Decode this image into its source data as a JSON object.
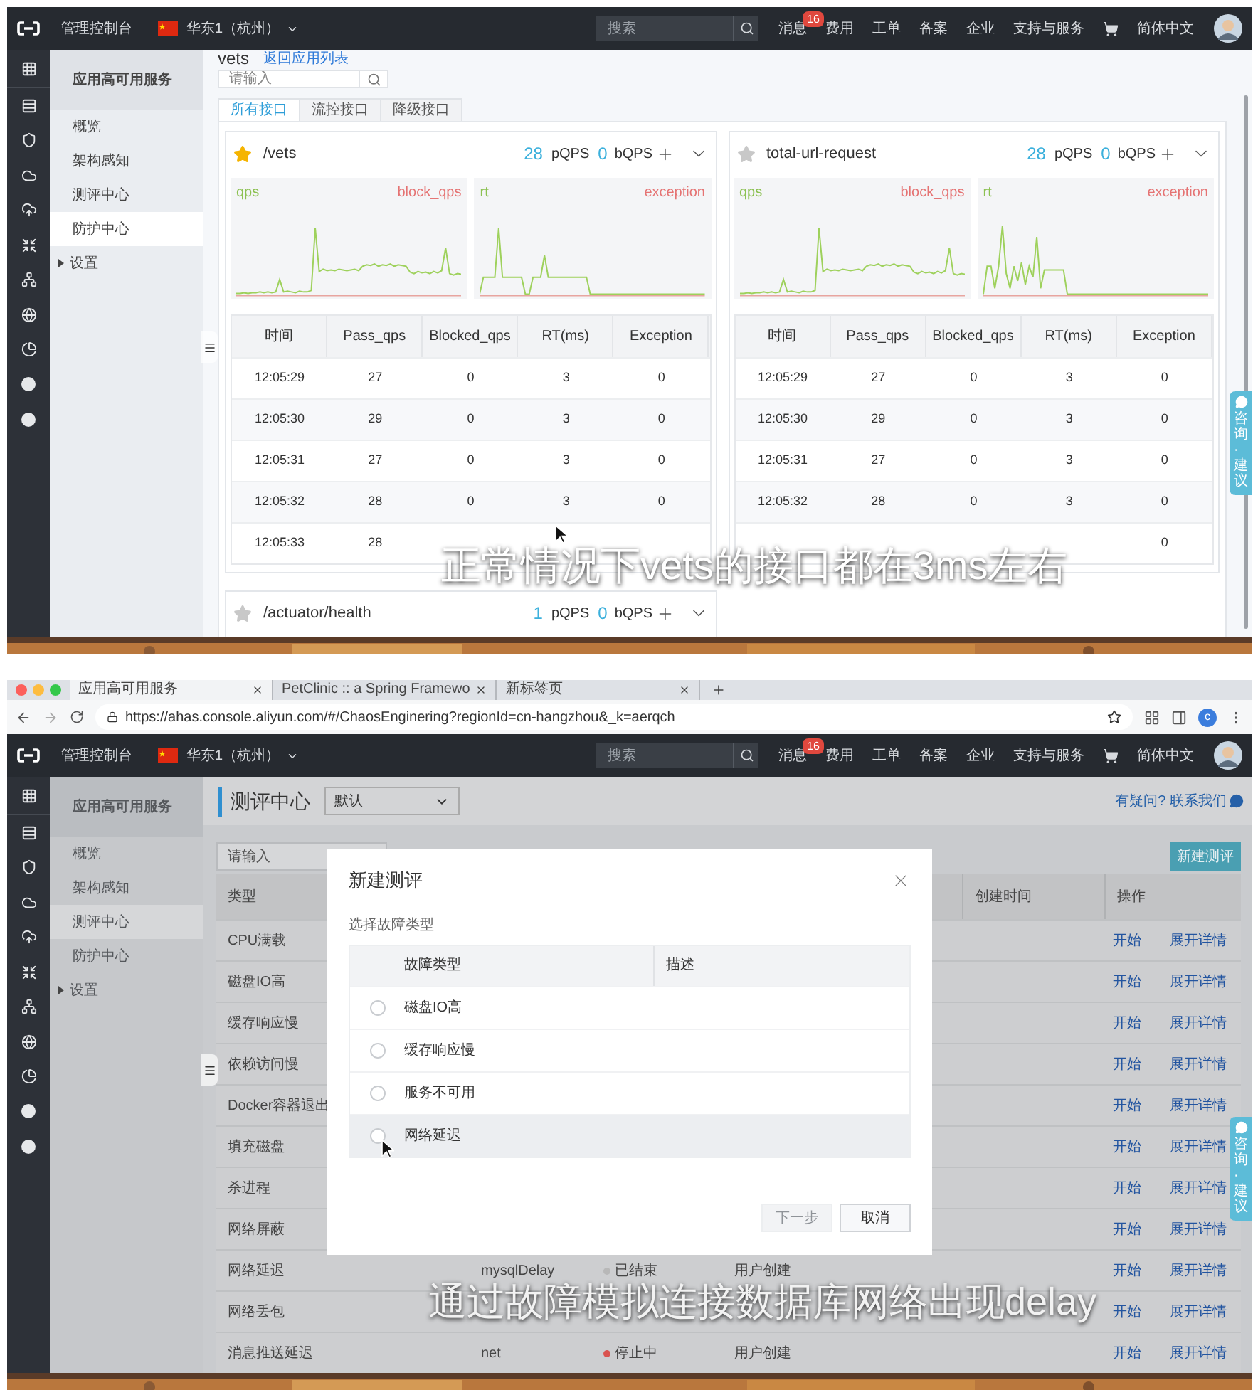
{
  "top_frame": {
    "header": {
      "console": "管理控制台",
      "region": "华东1（杭州）",
      "search_placeholder": "搜索",
      "nav": [
        {
          "label": "消息",
          "badge": "16"
        },
        {
          "label": "费用"
        },
        {
          "label": "工单"
        },
        {
          "label": "备案"
        },
        {
          "label": "企业"
        },
        {
          "label": "支持与服务"
        }
      ],
      "language": "简体中文"
    },
    "sidebar": {
      "title": "应用高可用服务",
      "items": [
        {
          "label": "概览",
          "selected": false,
          "expandable": false
        },
        {
          "label": "架构感知",
          "selected": false,
          "expandable": false
        },
        {
          "label": "测评中心",
          "selected": false,
          "expandable": false
        },
        {
          "label": "防护中心",
          "selected": true,
          "expandable": false
        },
        {
          "label": "设置",
          "selected": false,
          "expandable": true
        }
      ]
    },
    "app_title": "vets",
    "back_link": "返回应用列表",
    "search": {
      "placeholder": "请输入"
    },
    "tabs": [
      {
        "label": "所有接口",
        "selected": true
      },
      {
        "label": "流控接口",
        "selected": false
      },
      {
        "label": "降级接口",
        "selected": false
      }
    ],
    "cards": [
      {
        "name": "/vets",
        "starred": true,
        "pass_qps": "28",
        "pass_label": "pQPS",
        "block_qps": "0",
        "block_label": "bQPS",
        "charts": [
          {
            "kind": "qps",
            "left": "qps",
            "right": "block_qps"
          },
          {
            "kind": "rt",
            "left": "rt",
            "right": "exception"
          }
        ],
        "table": {
          "columns": [
            "时间",
            "Pass_qps",
            "Blocked_qps",
            "RT(ms)",
            "Exception"
          ],
          "rows": [
            [
              "12:05:29",
              "27",
              "0",
              "3",
              "0"
            ],
            [
              "12:05:30",
              "29",
              "0",
              "3",
              "0"
            ],
            [
              "12:05:31",
              "27",
              "0",
              "3",
              "0"
            ],
            [
              "12:05:32",
              "28",
              "0",
              "3",
              "0"
            ],
            [
              "12:05:33",
              "28",
              null,
              null,
              null
            ]
          ]
        }
      },
      {
        "name": "total-url-request",
        "starred": false,
        "pass_qps": "28",
        "pass_label": "pQPS",
        "block_qps": "0",
        "block_label": "bQPS",
        "charts": [
          {
            "kind": "qps",
            "left": "qps",
            "right": "block_qps"
          },
          {
            "kind": "rt2",
            "left": "rt",
            "right": "exception"
          }
        ],
        "table": {
          "columns": [
            "时间",
            "Pass_qps",
            "Blocked_qps",
            "RT(ms)",
            "Exception"
          ],
          "rows": [
            [
              "12:05:29",
              "27",
              "0",
              "3",
              "0"
            ],
            [
              "12:05:30",
              "29",
              "0",
              "3",
              "0"
            ],
            [
              "12:05:31",
              "27",
              "0",
              "3",
              "0"
            ],
            [
              "12:05:32",
              "28",
              "0",
              "3",
              "0"
            ],
            [
              null,
              null,
              null,
              null,
              "0"
            ]
          ]
        }
      },
      {
        "name": "/actuator/health",
        "starred": false,
        "pass_qps": "1",
        "pass_label": "pQPS",
        "block_qps": "0",
        "block_label": "bQPS"
      }
    ],
    "feedback_tab": "咨询·建议",
    "subtitle": "正常情况下vets的接口都在3ms左右"
  },
  "bottom_frame": {
    "browser": {
      "tabs": [
        {
          "title": "应用高可用服务",
          "selected": true
        },
        {
          "title": "PetClinic :: a Spring Framewo",
          "selected": false
        },
        {
          "title": "新标签页",
          "selected": false
        }
      ],
      "url": "https://ahas.console.aliyun.com/#/ChaosEnginering?regionId=cn-hangzhou&_k=aerqch",
      "profile": "c"
    },
    "header": {
      "console": "管理控制台",
      "region": "华东1（杭州）",
      "search_placeholder": "搜索",
      "nav": [
        {
          "label": "消息",
          "badge": "16"
        },
        {
          "label": "费用"
        },
        {
          "label": "工单"
        },
        {
          "label": "备案"
        },
        {
          "label": "企业"
        },
        {
          "label": "支持与服务"
        }
      ],
      "language": "简体中文"
    },
    "sidebar": {
      "title": "应用高可用服务",
      "items": [
        {
          "label": "概览",
          "selected": false,
          "expandable": false
        },
        {
          "label": "架构感知",
          "selected": false,
          "expandable": false
        },
        {
          "label": "测评中心",
          "selected": true,
          "expandable": false
        },
        {
          "label": "防护中心",
          "selected": false,
          "expandable": false
        },
        {
          "label": "设置",
          "selected": false,
          "expandable": true
        }
      ]
    },
    "page_title": "测评中心",
    "scope_select": "默认",
    "help_link": "有疑问? 联系我们",
    "search": {
      "placeholder": "请输入"
    },
    "new_button": "新建测评",
    "table": {
      "columns": [
        "类型",
        "创建时间",
        "操作"
      ],
      "rows": [
        {
          "type": "CPU满载",
          "actions": [
            "开始",
            "展开详情"
          ]
        },
        {
          "type": "磁盘IO高",
          "actions": [
            "开始",
            "展开详情"
          ]
        },
        {
          "type": "缓存响应慢",
          "actions": [
            "开始",
            "展开详情"
          ]
        },
        {
          "type": "依赖访问慢",
          "actions": [
            "开始",
            "展开详情"
          ]
        },
        {
          "type": "Docker容器退出",
          "actions": [
            "开始",
            "展开详情"
          ]
        },
        {
          "type": "填充磁盘",
          "actions": [
            "开始",
            "展开详情"
          ]
        },
        {
          "type": "杀进程",
          "actions": [
            "开始",
            "展开详情"
          ]
        },
        {
          "type": "网络屏蔽",
          "actions": [
            "开始",
            "展开详情"
          ]
        },
        {
          "type": "网络延迟",
          "name": "mysqlDelay",
          "status": {
            "label": "已结束",
            "color": "#b8b8b8"
          },
          "creator": "用户创建",
          "actions": [
            "开始",
            "展开详情"
          ]
        },
        {
          "type": "网络丢包",
          "actions": [
            "开始",
            "展开详情"
          ]
        },
        {
          "type": "消息推送延迟",
          "name": "net",
          "status": {
            "label": "停止中",
            "color": "#d9534f"
          },
          "creator": "用户创建",
          "actions": [
            "开始",
            "展开详情"
          ]
        }
      ]
    },
    "modal": {
      "title": "新建测评",
      "section": "选择故障类型",
      "columns": [
        "故障类型",
        "描述"
      ],
      "options": [
        {
          "label": "磁盘IO高",
          "selected": false,
          "hovered": false
        },
        {
          "label": "缓存响应慢",
          "selected": false,
          "hovered": false
        },
        {
          "label": "服务不可用",
          "selected": false,
          "hovered": false
        },
        {
          "label": "网络延迟",
          "selected": false,
          "hovered": true
        }
      ],
      "buttons": [
        {
          "label": "下一步",
          "disabled": true
        },
        {
          "label": "取消",
          "disabled": false
        }
      ]
    },
    "feedback_tab": "咨询·建议",
    "subtitle": "通过故障模拟连接数据库网络出现delay"
  }
}
